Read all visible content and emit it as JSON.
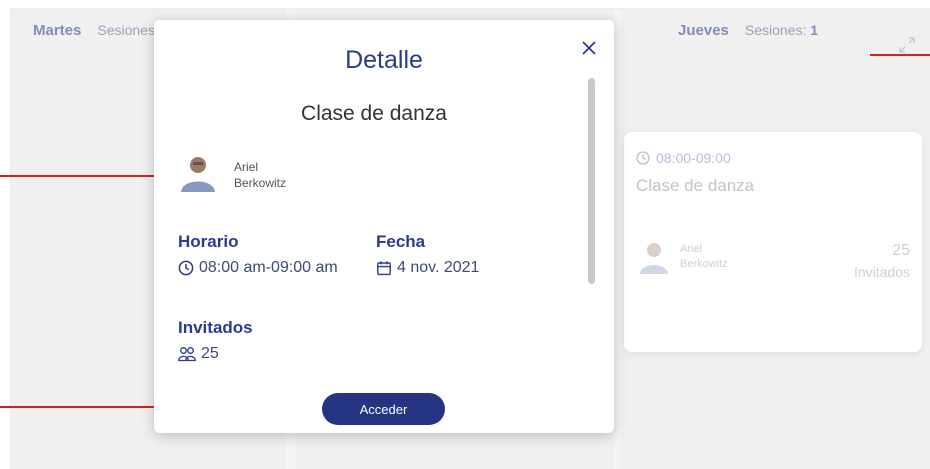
{
  "calendar": {
    "columns": [
      {
        "day": "Martes",
        "sessions_label": "Sesiones:"
      },
      {
        "day": "Jueves",
        "sessions_label": "Sesiones:",
        "sessions_count": "1"
      }
    ],
    "session_card": {
      "time": "08:00-09:00",
      "title": "Clase de danza",
      "host_first": "Ariel",
      "host_last": "Berkowitz",
      "count": "25",
      "count_label": "Invitados"
    }
  },
  "modal": {
    "title": "Detalle",
    "class_name": "Clase de danza",
    "host_first": "Ariel",
    "host_last": "Berkowitz",
    "horario_label": "Horario",
    "horario_value": "08:00 am-09:00 am",
    "fecha_label": "Fecha",
    "fecha_value": "4 nov. 2021",
    "invitados_label": "Invitados",
    "invitados_value": "25",
    "button_label": "Acceder"
  },
  "colors": {
    "accent": "#2b3a8c",
    "button": "#253583",
    "annotation_line": "#d62020"
  },
  "icons": [
    "close-icon",
    "clock-icon",
    "calendar-icon",
    "people-icon",
    "expand-icon",
    "avatar"
  ]
}
